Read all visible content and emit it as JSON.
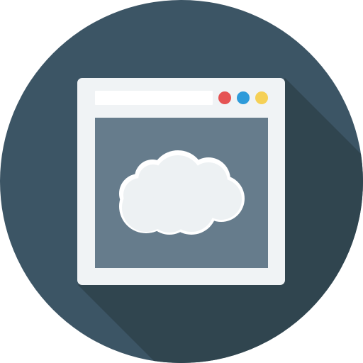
{
  "icon": {
    "name": "cloud-browser-window-icon"
  },
  "colors": {
    "background_circle": "#3C5565",
    "long_shadow": "#30454F",
    "window_frame": "#F0F3F5",
    "address_bar": "#FFFFFF",
    "content_area": "#667C8C",
    "cloud_fill": "#EDF1F3",
    "cloud_outline": "#FFFFFF",
    "dot_red": "#E55353",
    "dot_blue": "#2E9BDA",
    "dot_yellow": "#F5D056"
  },
  "window_controls": [
    {
      "name": "red",
      "color_key": "dot_red"
    },
    {
      "name": "blue",
      "color_key": "dot_blue"
    },
    {
      "name": "yellow",
      "color_key": "dot_yellow"
    }
  ]
}
